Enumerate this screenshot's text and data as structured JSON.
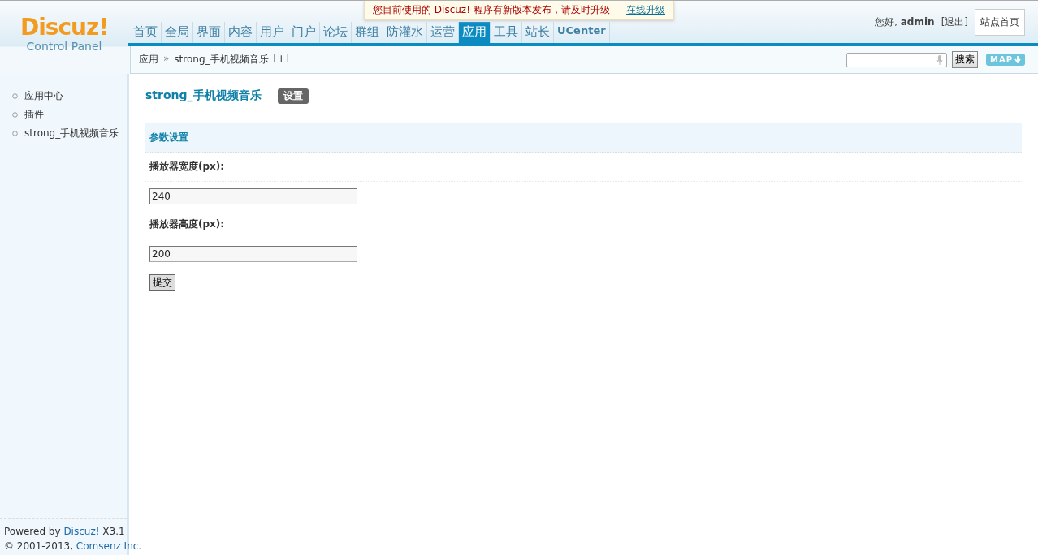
{
  "notice": {
    "text": "您目前使用的 Discuz! 程序有新版本发布，请及时升级",
    "link": "在线升级"
  },
  "logo": {
    "name": "Discuz!",
    "subtitle": "Control Panel"
  },
  "nav": [
    {
      "label": "首页",
      "selected": false
    },
    {
      "label": "全局",
      "selected": false
    },
    {
      "label": "界面",
      "selected": false
    },
    {
      "label": "内容",
      "selected": false
    },
    {
      "label": "用户",
      "selected": false
    },
    {
      "label": "门户",
      "selected": false
    },
    {
      "label": "论坛",
      "selected": false
    },
    {
      "label": "群组",
      "selected": false
    },
    {
      "label": "防灌水",
      "selected": false
    },
    {
      "label": "运营",
      "selected": false
    },
    {
      "label": "应用",
      "selected": true
    },
    {
      "label": "工具",
      "selected": false
    },
    {
      "label": "站长",
      "selected": false
    },
    {
      "label": "UCenter",
      "selected": false
    }
  ],
  "user": {
    "greeting": "您好, **admin**",
    "logout": "[退出]",
    "home": "站点首页"
  },
  "breadcrumb": {
    "items": [
      "应用",
      "strong_手机视频音乐"
    ],
    "separator": "»",
    "add": "[+]"
  },
  "search": {
    "button": "搜索",
    "map": "MAP"
  },
  "sidebar": {
    "items": [
      {
        "label": "应用中心",
        "selected": false
      },
      {
        "label": "插件",
        "selected": false
      },
      {
        "label": "strong_手机视频音乐",
        "selected": false
      }
    ]
  },
  "footer": [
    {
      "before": "Powered by ",
      "link": "Discuz!",
      "after": " X3.1"
    },
    {
      "before": "© 2001-2013, ",
      "link": "Comsenz Inc."
    }
  ],
  "main": {
    "title": "strong_手机视频音乐",
    "tabs": [
      {
        "label": "设置",
        "selected": true
      }
    ],
    "section": "参数设置",
    "fields": [
      {
        "label": "播放器宽度(px):",
        "value": "240"
      },
      {
        "label": "播放器高度(px):",
        "value": "200"
      }
    ],
    "submit": "提交"
  }
}
